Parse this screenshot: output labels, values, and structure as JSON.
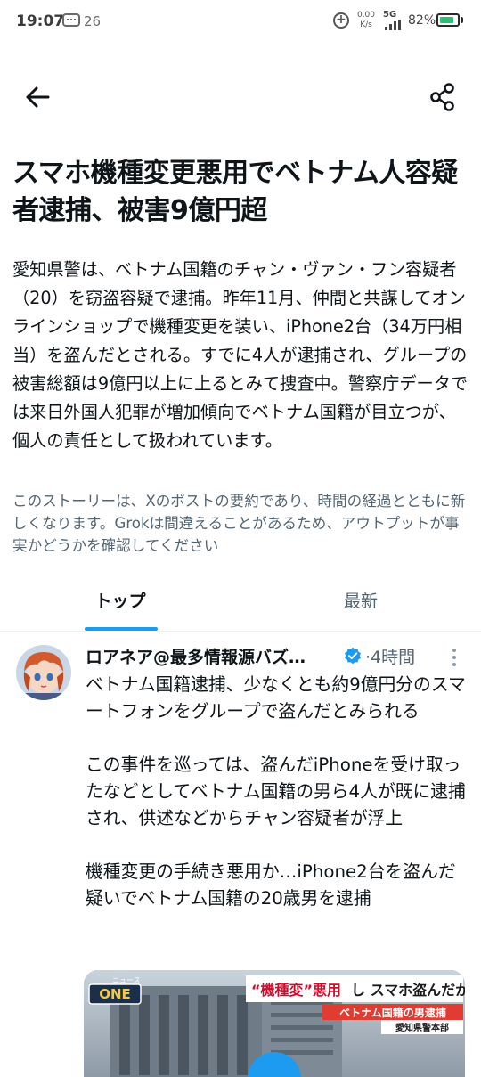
{
  "status_bar": {
    "time": "19:07",
    "notification_count": "26",
    "net_speed_value": "0.00",
    "net_speed_unit": "K/s",
    "network": "5G",
    "battery": "82%",
    "battery_level": 0.82,
    "battery_color": "#2dbd74"
  },
  "header": {
    "back_icon": "arrow-left-icon",
    "share_icon": "share-icon"
  },
  "article": {
    "headline": "スマホ機種変更悪用でベトナム人容疑者逮捕、被害9億円超",
    "summary": "愛知県警は、ベトナム国籍のチャン・ヴァン・フン容疑者（20）を窃盗容疑で逮捕。昨年11月、仲間と共謀してオンラインショップで機種変更を装い、iPhone2台（34万円相当）を盗んだとされる。すでに4人が逮捕され、グループの被害総額は9億円以上に上るとみて捜査中。警察庁データでは来日外国人犯罪が増加傾向でベトナム国籍が目立つが、個人の責任として扱われています。",
    "disclaimer": "このストーリーは、Xのポストの要約であり、時間の経過とともに新しくなります。Grokは間違えることがあるため、アウトプットが事実かどうかを確認してください"
  },
  "tabs": [
    {
      "label": "トップ",
      "active": true
    },
    {
      "label": "最新",
      "active": false
    }
  ],
  "accent_color": "#1d9bf0",
  "post": {
    "author": "ロアネア@最多情報源バズ…",
    "verified_icon": "verified-badge-icon",
    "time": "·4時間",
    "paragraphs": [
      "ベトナム国籍逮捕、少なくとも約9億円分のスマートフォンをグループで盗んだとみられる",
      "この事件を巡っては、盗んだiPhoneを受け取ったなどとしてベトナム国籍の男ら4人が既に逮捕され、供述などからチャン容疑者が浮上",
      "機種変更の手続き悪用か…iPhone2台を盗んだ疑いでベトナム国籍の20歳男を逮捕"
    ],
    "image": {
      "logo_small": "ニュース",
      "logo": "ONE",
      "headline_quote": "“機種変”悪用",
      "headline_rest": "し スマホ盗んだか",
      "subtitle": "ベトナム国籍の男逮捕",
      "caption": "愛知県警本部"
    }
  }
}
